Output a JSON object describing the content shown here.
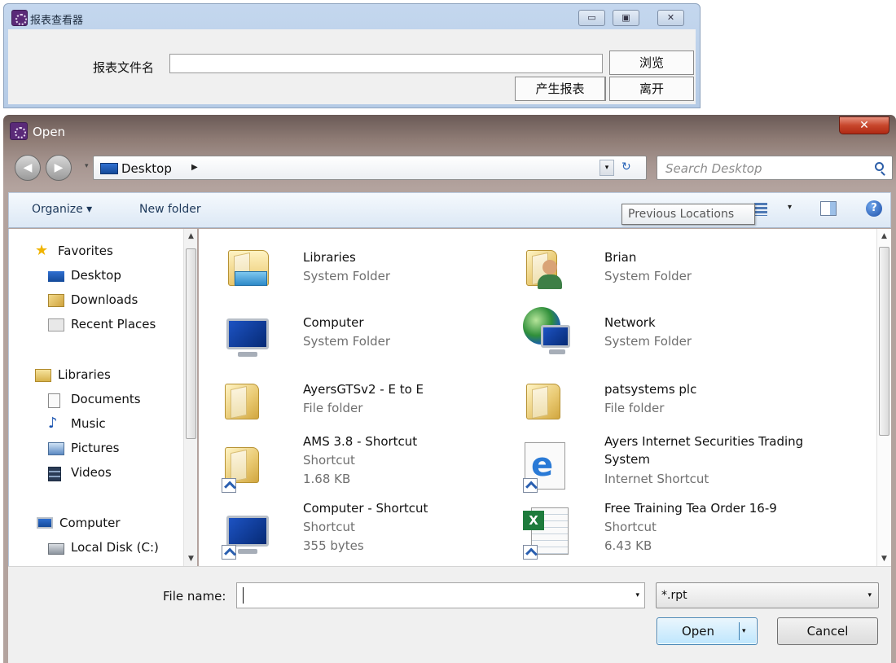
{
  "report_viewer": {
    "title": "报表查看器",
    "file_label": "报表文件名",
    "file_value": "",
    "browse_label": "浏览",
    "generate_label": "产生报表",
    "exit_label": "离开",
    "minimize_glyph": "▭",
    "maximize_glyph": "▣",
    "close_glyph": "✕"
  },
  "open_dialog": {
    "title": "Open",
    "close_glyph": "✕",
    "back_glyph": "◀",
    "forward_glyph": "▶",
    "nav_dropdown_glyph": "▾",
    "address": {
      "location": "Desktop",
      "chevron": "▶",
      "dropdown_glyph": "▾",
      "refresh_glyph": "↻"
    },
    "search": {
      "placeholder": "Search Desktop"
    },
    "toolbar": {
      "organize_label": "Organize ▾",
      "new_folder_label": "New folder",
      "tooltip": "Previous Locations",
      "views_dropdown_glyph": "▾",
      "help_glyph": "?"
    },
    "nav_pane": {
      "favorites_header": "Favorites",
      "favorites": [
        "Desktop",
        "Downloads",
        "Recent Places"
      ],
      "libraries_header": "Libraries",
      "libraries": [
        "Documents",
        "Music",
        "Pictures",
        "Videos"
      ],
      "computer_header": "Computer",
      "computer": [
        "Local Disk (C:)"
      ]
    },
    "items": [
      {
        "name": "Libraries",
        "type": "System Folder",
        "size": "",
        "icon": "libraries-icon"
      },
      {
        "name": "Brian",
        "type": "System Folder",
        "size": "",
        "icon": "user-folder-icon"
      },
      {
        "name": "Computer",
        "type": "System Folder",
        "size": "",
        "icon": "computer-icon"
      },
      {
        "name": "Network",
        "type": "System Folder",
        "size": "",
        "icon": "network-icon"
      },
      {
        "name": "AyersGTSv2 - E to E",
        "type": "File folder",
        "size": "",
        "icon": "folder-icon"
      },
      {
        "name": "patsystems plc",
        "type": "File folder",
        "size": "",
        "icon": "folder-icon"
      },
      {
        "name": "AMS 3.8 - Shortcut",
        "type": "Shortcut",
        "size": "1.68 KB",
        "icon": "folder-shortcut-icon"
      },
      {
        "name": "Ayers Internet Securities Trading System",
        "type": "Internet Shortcut",
        "size": "",
        "icon": "internet-explorer-icon"
      },
      {
        "name": "Computer - Shortcut",
        "type": "Shortcut",
        "size": "355 bytes",
        "icon": "computer-shortcut-icon"
      },
      {
        "name": "Free Training Tea Order 16-9",
        "type": "Shortcut",
        "size": "6.43 KB",
        "icon": "excel-shortcut-icon"
      }
    ],
    "bottom": {
      "file_name_label": "File name:",
      "file_name_value": "",
      "file_type": "*.rpt",
      "dropdown_glyph": "▾",
      "open_label": "Open",
      "cancel_label": "Cancel"
    }
  },
  "colors": {
    "title_bar_blue": "#c4d7ee",
    "dialog_frame": "#8e7b74",
    "close_red": "#c7462c",
    "open_button": "#bee6fd"
  }
}
